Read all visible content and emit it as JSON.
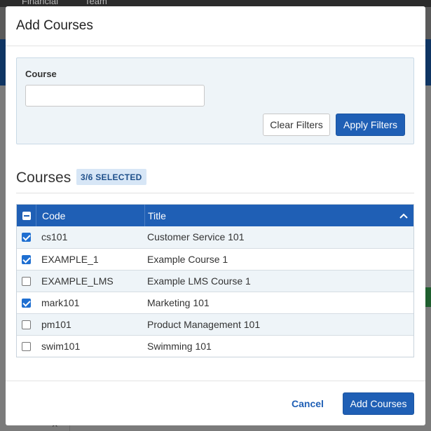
{
  "background": {
    "nav_tabs": [
      "Financial",
      "Team"
    ]
  },
  "modal": {
    "title": "Add Courses",
    "filter": {
      "label": "Course",
      "value": "",
      "placeholder": "",
      "clear_label": "Clear Filters",
      "apply_label": "Apply Filters"
    },
    "section_title": "Courses",
    "selected_badge": "3/6 SELECTED",
    "table": {
      "columns": [
        "Code",
        "Title"
      ],
      "rows": [
        {
          "checked": true,
          "code": "cs101",
          "title": "Customer Service 101"
        },
        {
          "checked": true,
          "code": "EXAMPLE_1",
          "title": "Example Course 1"
        },
        {
          "checked": false,
          "code": "EXAMPLE_LMS",
          "title": "Example LMS Course 1"
        },
        {
          "checked": true,
          "code": "mark101",
          "title": "Marketing 101"
        },
        {
          "checked": false,
          "code": "pm101",
          "title": "Product Management 101"
        },
        {
          "checked": false,
          "code": "swim101",
          "title": "Swimming 101"
        }
      ]
    },
    "footer": {
      "cancel_label": "Cancel",
      "add_label": "Add Courses"
    }
  },
  "colors": {
    "primary": "#1f5fb5",
    "checkbox": "#1f6fd1",
    "badge_bg": "#d7e6f6",
    "filter_bg": "#eef4f8"
  }
}
